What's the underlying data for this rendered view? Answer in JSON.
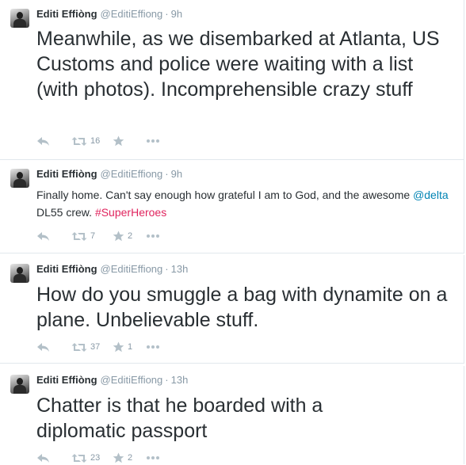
{
  "tweets": [
    {
      "name": "Editi Effiòng",
      "handle": "@EditiEffiong",
      "sep": "·",
      "time": "9h",
      "text": "Meanwhile, as we disembarked at Atlanta, US Customs and police were waiting with a list (with photos). Incomprehensible crazy stuff",
      "retweets": "16",
      "favorites": ""
    },
    {
      "name": "Editi Effiòng",
      "handle": "@EditiEffiong",
      "sep": "·",
      "time": "9h",
      "text_before": "Finally home. Can't say enough how grateful I am to God, and the awesome ",
      "mention": "@delta",
      "text_middle": " DL55 crew. ",
      "hashtag": "#SuperHeroes",
      "retweets": "7",
      "favorites": "2"
    },
    {
      "name": "Editi Effiòng",
      "handle": "@EditiEffiong",
      "sep": "·",
      "time": "13h",
      "text": "How do you smuggle a bag with dynamite on a plane. Unbelievable stuff.",
      "retweets": "37",
      "favorites": "1"
    },
    {
      "name": "Editi Effiòng",
      "handle": "@EditiEffiong",
      "sep": "·",
      "time": "13h",
      "text": "Chatter is that he boarded with a diplomatic passport",
      "retweets": "23",
      "favorites": "2"
    }
  ],
  "icons": {
    "reply": "reply-icon",
    "retweet": "retweet-icon",
    "favorite": "star-icon",
    "more": "more-icon"
  },
  "colors": {
    "text": "#292f33",
    "muted": "#8899a6",
    "icon": "#a8b5bd",
    "mention": "#0084b4",
    "hashtag": "#e0245e",
    "border": "#e1e8ed"
  }
}
